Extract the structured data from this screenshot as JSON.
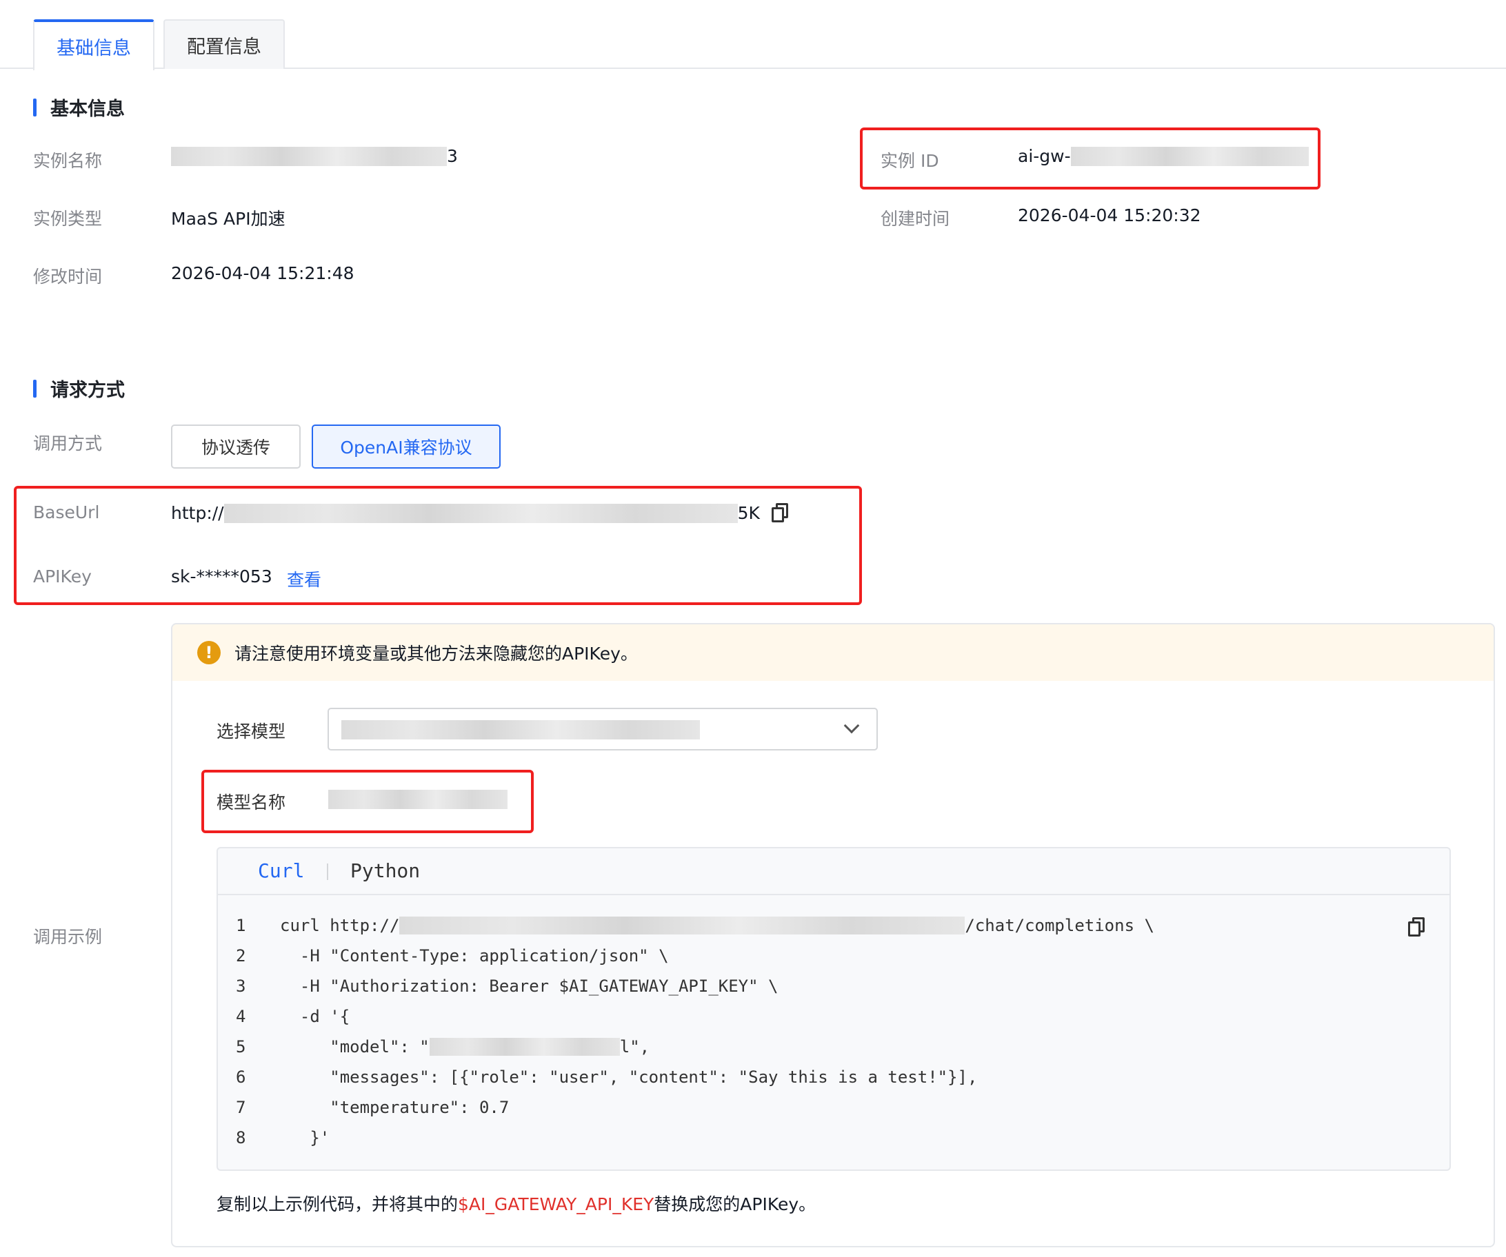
{
  "tabs": [
    {
      "label": "基础信息",
      "active": true
    },
    {
      "label": "配置信息",
      "active": false
    }
  ],
  "basic_section": {
    "title": "基本信息",
    "instance_name_label": "实例名称",
    "instance_name_value_tail": "3",
    "instance_id_label": "实例 ID",
    "instance_id_prefix": "ai-gw-",
    "instance_type_label": "实例类型",
    "instance_type_value": "MaaS API加速",
    "created_label": "创建时间",
    "created_value": "2026-04-04 15:20:32",
    "modified_label": "修改时间",
    "modified_value": "2026-04-04 15:21:48"
  },
  "request_section": {
    "title": "请求方式",
    "call_mode_label": "调用方式",
    "mode_buttons": [
      {
        "label": "协议透传",
        "active": false
      },
      {
        "label": "OpenAI兼容协议",
        "active": true
      }
    ],
    "base_url_label": "BaseUrl",
    "base_url_prefix": "http://",
    "base_url_tail": "5K",
    "api_key_label": "APIKey",
    "api_key_value": "sk-*****053",
    "api_key_view_link": "查看",
    "example_label": "调用示例"
  },
  "example": {
    "notice": "请注意使用环境变量或其他方法来隐藏您的APIKey。",
    "select_model_label": "选择模型",
    "model_name_label": "模型名称",
    "code_tabs": [
      {
        "label": "Curl",
        "active": true
      },
      {
        "label": "Python",
        "active": false
      }
    ],
    "code_lines": [
      {
        "n": "1",
        "pre": "curl http://",
        "post": "/chat/completions \\"
      },
      {
        "n": "2",
        "text": "  -H \"Content-Type: application/json\" \\"
      },
      {
        "n": "3",
        "text": "  -H \"Authorization: Bearer $AI_GATEWAY_API_KEY\" \\"
      },
      {
        "n": "4",
        "text": "  -d '{"
      },
      {
        "n": "5",
        "pre": "     \"model\": \"",
        "post": "l\","
      },
      {
        "n": "6",
        "text": "     \"messages\": [{\"role\": \"user\", \"content\": \"Say this is a test!\"}],"
      },
      {
        "n": "7",
        "text": "     \"temperature\": 0.7"
      },
      {
        "n": "8",
        "text": "   }'"
      }
    ],
    "footer_prefix": "复制以上示例代码，并将其中的",
    "footer_highlight": "$AI_GATEWAY_API_KEY",
    "footer_suffix": "替换成您的APIKey。"
  },
  "colors": {
    "accent": "#2468f2",
    "highlight_box": "#f01f1f",
    "warning": "#e49b0f"
  }
}
